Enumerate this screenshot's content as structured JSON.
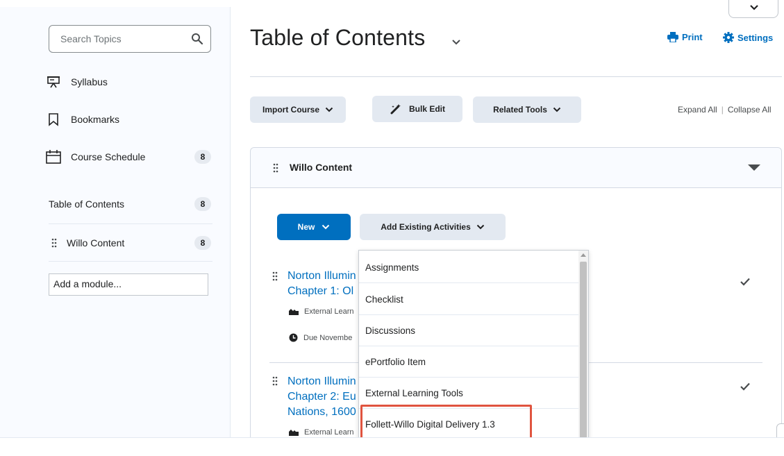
{
  "sidebar": {
    "search_placeholder": "Search Topics",
    "nav": [
      {
        "label": "Syllabus",
        "icon": "presentation-icon"
      },
      {
        "label": "Bookmarks",
        "icon": "bookmark-icon"
      },
      {
        "label": "Course Schedule",
        "icon": "calendar-icon",
        "count": "8"
      }
    ],
    "toc": {
      "label": "Table of Contents",
      "count": "8"
    },
    "module": {
      "label": "Willo Content",
      "count": "8"
    },
    "add_module_placeholder": "Add a module..."
  },
  "header": {
    "title": "Table of Contents",
    "print_label": "Print",
    "settings_label": "Settings"
  },
  "toolbar": {
    "import_label": "Import Course",
    "bulk_edit_label": "Bulk Edit",
    "related_tools_label": "Related Tools",
    "expand_all": "Expand All",
    "separator": "|",
    "collapse_all": "Collapse All"
  },
  "module_panel": {
    "title": "Willo Content",
    "new_label": "New",
    "add_existing_label": "Add Existing Activities"
  },
  "topics": [
    {
      "title_line1": "Norton Illumin",
      "title_line2": "Chapter 1: Ol",
      "type": "External Learn",
      "due": "Due Novembe"
    },
    {
      "title_line1": "Norton Illumin",
      "title_line2": "Chapter 2: Eu",
      "title_line3": "Nations, 1600",
      "type": "External Learn"
    }
  ],
  "dropdown": {
    "items": [
      "Assignments",
      "Checklist",
      "Discussions",
      "ePortfolio Item",
      "External Learning Tools",
      "Follett-Willo Digital Delivery 1.3"
    ],
    "highlighted_index": 5
  },
  "colors": {
    "accent": "#006fbf",
    "highlight_border": "#e0543f"
  }
}
